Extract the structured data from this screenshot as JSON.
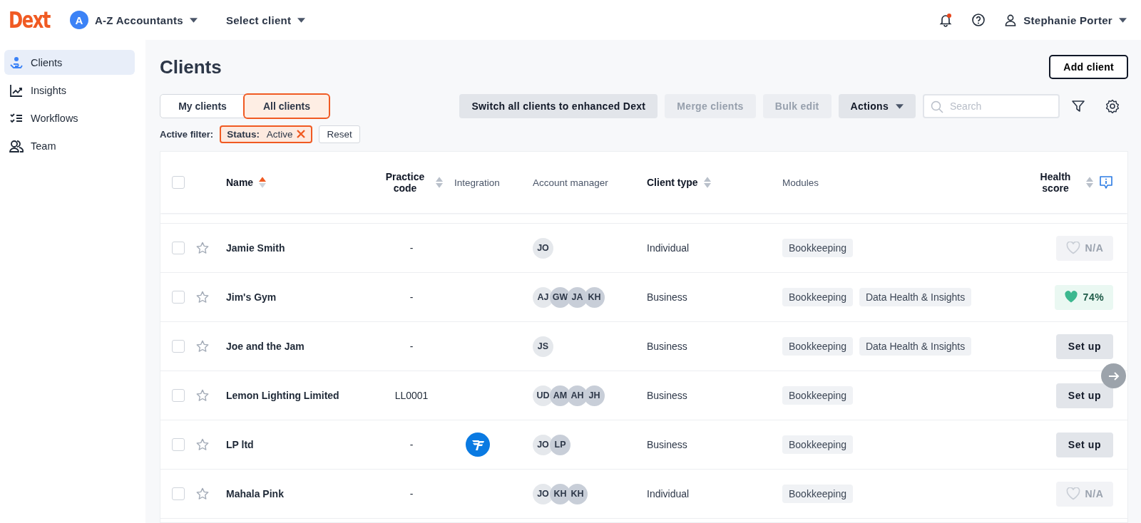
{
  "topbar": {
    "logo": "Dext",
    "practice": {
      "initial": "A",
      "name": "A-Z Accountants"
    },
    "client_select": "Select client",
    "has_notification": true,
    "user": "Stephanie Porter"
  },
  "sidebar": {
    "items": [
      {
        "label": "Clients",
        "selected": true
      },
      {
        "label": "Insights",
        "selected": false
      },
      {
        "label": "Workflows",
        "selected": false
      },
      {
        "label": "Team",
        "selected": false
      }
    ]
  },
  "page": {
    "title": "Clients",
    "add_button": "Add client"
  },
  "tabs": [
    {
      "label": "My clients",
      "selected": false
    },
    {
      "label": "All clients",
      "selected": true
    }
  ],
  "toolbar": {
    "buttons": [
      {
        "label": "Switch all clients to enhanced Dext",
        "disabled": false,
        "dropdown": false
      },
      {
        "label": "Merge clients",
        "disabled": true,
        "dropdown": false
      },
      {
        "label": "Bulk edit",
        "disabled": true,
        "dropdown": false
      },
      {
        "label": "Actions",
        "disabled": false,
        "dropdown": true
      }
    ],
    "search": {
      "placeholder": "Search"
    }
  },
  "filter": {
    "label": "Active filter:",
    "chip": {
      "key": "Status:",
      "value": "Active"
    },
    "reset": "Reset"
  },
  "table": {
    "select_all_checked": false,
    "columns": [
      {
        "label": "Name",
        "sortable": true,
        "sorted": true
      },
      {
        "label": "Practice code",
        "sortable": true,
        "sorted": false
      },
      {
        "label": "Integration",
        "sortable": false
      },
      {
        "label": "Account manager",
        "sortable": false
      },
      {
        "label": "Client type",
        "sortable": true,
        "sorted": false
      },
      {
        "label": "Modules",
        "sortable": false
      },
      {
        "label": "Health score",
        "sortable": true,
        "sorted": false
      }
    ],
    "rows": [
      {
        "checked": false,
        "starred": false,
        "name": "Jamie Smith",
        "practice_code": "-",
        "integration": false,
        "managers": [
          "JO"
        ],
        "client_type": "Individual",
        "modules": [
          "Bookkeeping"
        ],
        "health": {
          "kind": "na",
          "text": "N/A"
        }
      },
      {
        "checked": false,
        "starred": false,
        "name": "Jim's Gym",
        "practice_code": "-",
        "integration": false,
        "managers": [
          "AJ",
          "GW",
          "JA",
          "KH"
        ],
        "client_type": "Business",
        "modules": [
          "Bookkeeping",
          "Data Health & Insights"
        ],
        "health": {
          "kind": "score",
          "text": "74%"
        }
      },
      {
        "checked": false,
        "starred": false,
        "name": "Joe and the Jam",
        "practice_code": "-",
        "integration": false,
        "managers": [
          "JS"
        ],
        "client_type": "Business",
        "modules": [
          "Bookkeeping",
          "Data Health & Insights"
        ],
        "health": {
          "kind": "setup",
          "text": "Set up"
        }
      },
      {
        "checked": false,
        "starred": false,
        "name": "Lemon Lighting Limited",
        "practice_code": "LL0001",
        "integration": false,
        "managers": [
          "UD",
          "AM",
          "AH",
          "JH"
        ],
        "client_type": "Business",
        "modules": [
          "Bookkeeping"
        ],
        "health": {
          "kind": "setup",
          "text": "Set up"
        }
      },
      {
        "checked": false,
        "starred": false,
        "name": "LP ltd",
        "practice_code": "-",
        "integration": true,
        "managers": [
          "JO",
          "LP"
        ],
        "client_type": "Business",
        "modules": [
          "Bookkeeping"
        ],
        "health": {
          "kind": "setup",
          "text": "Set up"
        }
      },
      {
        "checked": false,
        "starred": false,
        "name": "Mahala Pink",
        "practice_code": "-",
        "integration": false,
        "managers": [
          "JO",
          "KH",
          "KH"
        ],
        "client_type": "Individual",
        "modules": [
          "Bookkeeping"
        ],
        "health": {
          "kind": "na",
          "text": "N/A"
        }
      }
    ]
  }
}
